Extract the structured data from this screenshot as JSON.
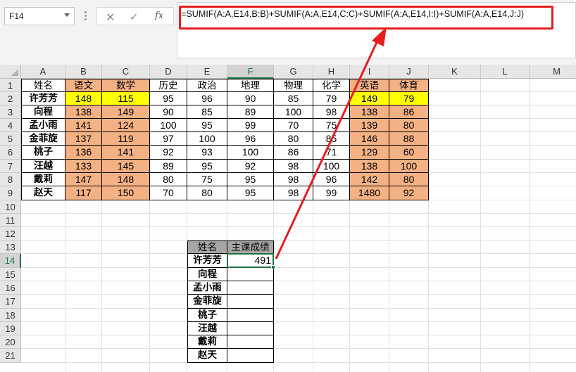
{
  "namebox": {
    "value": "F14"
  },
  "formula_bar": {
    "cancel_glyph": "✕",
    "enter_glyph": "✓",
    "fx_label": "fx",
    "formula": "=SUMIF(A:A,E14,B:B)+SUMIF(A:A,E14,C:C)+SUMIF(A:A,E14,I:I)+SUMIF(A:A,E14,J:J)"
  },
  "columns": [
    "A",
    "B",
    "C",
    "D",
    "E",
    "F",
    "G",
    "H",
    "I",
    "J",
    "K",
    "L",
    "M"
  ],
  "rows": [
    "1",
    "2",
    "3",
    "4",
    "5",
    "6",
    "7",
    "8",
    "9",
    "10",
    "11",
    "12",
    "13",
    "14",
    "15",
    "16",
    "17",
    "18",
    "19",
    "20",
    "21"
  ],
  "selected": {
    "column": "F",
    "row": "14"
  },
  "main_table": {
    "header": [
      "姓名",
      "语文",
      "数学",
      "历史",
      "政治",
      "地理",
      "物理",
      "化学",
      "英语",
      "体育"
    ],
    "rows": [
      [
        "许芳芳",
        "148",
        "115",
        "95",
        "96",
        "90",
        "85",
        "79",
        "149",
        "79"
      ],
      [
        "向程",
        "138",
        "149",
        "90",
        "85",
        "89",
        "100",
        "98",
        "138",
        "86"
      ],
      [
        "孟小雨",
        "141",
        "124",
        "100",
        "95",
        "99",
        "70",
        "75",
        "139",
        "80"
      ],
      [
        "金菲旋",
        "137",
        "119",
        "97",
        "100",
        "96",
        "80",
        "85",
        "146",
        "88"
      ],
      [
        "桃子",
        "136",
        "141",
        "92",
        "93",
        "100",
        "86",
        "71",
        "129",
        "60"
      ],
      [
        "汪越",
        "133",
        "145",
        "89",
        "95",
        "92",
        "98",
        "100",
        "138",
        "100"
      ],
      [
        "戴莉",
        "147",
        "148",
        "80",
        "75",
        "95",
        "98",
        "96",
        "142",
        "80"
      ],
      [
        "赵天",
        "117",
        "150",
        "70",
        "80",
        "95",
        "98",
        "99",
        "1480",
        "92"
      ]
    ]
  },
  "summary_table": {
    "header": [
      "姓名",
      "主课成绩"
    ],
    "names": [
      "许芳芳",
      "向程",
      "孟小雨",
      "金菲旋",
      "桃子",
      "汪越",
      "戴莉",
      "赵天"
    ],
    "values": [
      "491",
      "",
      "",
      "",
      "",
      "",
      "",
      ""
    ]
  },
  "colors": {
    "main_subject": "#f4b183",
    "highlight_row": "#ffff00",
    "summary_header": "#a6a6a6",
    "accent": "#217346",
    "annotation": "#e61e1e"
  }
}
